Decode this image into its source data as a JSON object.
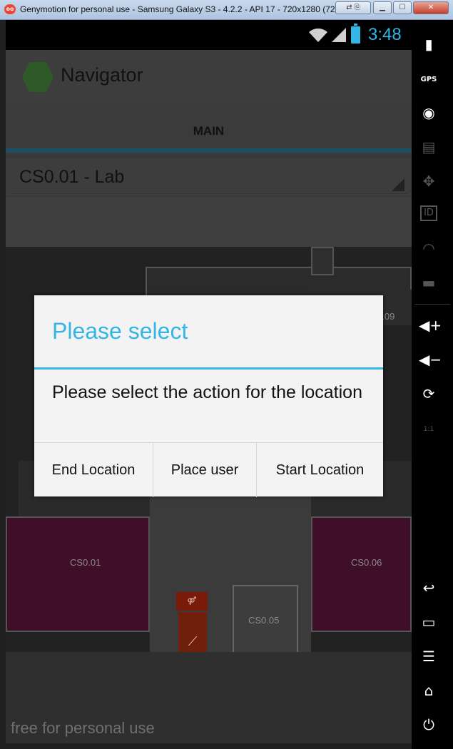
{
  "window": {
    "title": "Genymotion for personal use - Samsung Galaxy S3 - 4.2.2 - API 17 - 720x1280 (720x1280...",
    "logo_text": "oo",
    "controls": [
      "minimize-icon",
      "maximize-icon",
      "close-icon"
    ]
  },
  "statusbar": {
    "time": "3:48",
    "icons": [
      "wifi-icon",
      "signal-icon",
      "battery-icon"
    ]
  },
  "app": {
    "title": "Navigator",
    "tab": "MAIN",
    "location_selected": "CS0.01 - Lab"
  },
  "map": {
    "rooms": [
      {
        "label": "CS0.09"
      },
      {
        "label": "CS0.01"
      },
      {
        "label": "CS0.06"
      },
      {
        "label": "CS0.05"
      }
    ]
  },
  "dialog": {
    "title": "Please select",
    "message": "Please select the action for the location",
    "buttons": {
      "end": "End Location",
      "place": "Place user",
      "start": "Start Location"
    }
  },
  "watermark": "free for personal use",
  "sidebar": {
    "gps_label": "GPS",
    "id_label": "ID",
    "scale_label": "1:1"
  },
  "colors": {
    "accent": "#33b5e5",
    "room_purple": "#3f0e28",
    "dialog_bg": "#f3f3f3"
  }
}
